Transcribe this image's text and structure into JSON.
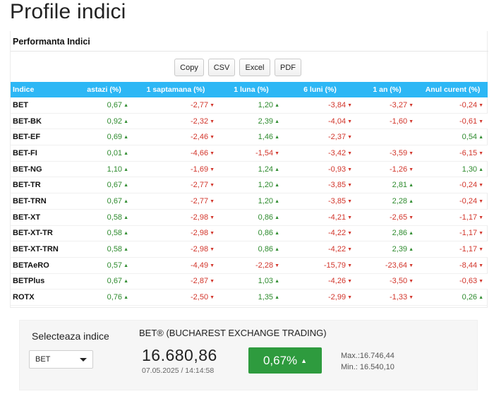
{
  "page": {
    "title": "Profile indici"
  },
  "performance": {
    "title": "Performanta Indici",
    "export_buttons": [
      "Copy",
      "CSV",
      "Excel",
      "PDF"
    ],
    "columns": [
      "Indice",
      "astazi (%)",
      "1 saptamana (%)",
      "1 luna (%)",
      "6 luni (%)",
      "1 an (%)",
      "Anul curent (%)"
    ],
    "rows": [
      {
        "name": "BET",
        "cells": [
          "0,67",
          "-2,77",
          "1,20",
          "-3,84",
          "-3,27",
          "-0,24"
        ]
      },
      {
        "name": "BET-BK",
        "cells": [
          "0,92",
          "-2,32",
          "2,39",
          "-4,04",
          "-1,60",
          "-0,61"
        ]
      },
      {
        "name": "BET-EF",
        "cells": [
          "0,69",
          "-2,46",
          "1,46",
          "-2,37",
          "",
          "0,54"
        ]
      },
      {
        "name": "BET-FI",
        "cells": [
          "0,01",
          "-4,66",
          "-1,54",
          "-3,42",
          "-3,59",
          "-6,15"
        ]
      },
      {
        "name": "BET-NG",
        "cells": [
          "1,10",
          "-1,69",
          "1,24",
          "-0,93",
          "-1,26",
          "1,30"
        ]
      },
      {
        "name": "BET-TR",
        "cells": [
          "0,67",
          "-2,77",
          "1,20",
          "-3,85",
          "2,81",
          "-0,24"
        ]
      },
      {
        "name": "BET-TRN",
        "cells": [
          "0,67",
          "-2,77",
          "1,20",
          "-3,85",
          "2,28",
          "-0,24"
        ]
      },
      {
        "name": "BET-XT",
        "cells": [
          "0,58",
          "-2,98",
          "0,86",
          "-4,21",
          "-2,65",
          "-1,17"
        ]
      },
      {
        "name": "BET-XT-TR",
        "cells": [
          "0,58",
          "-2,98",
          "0,86",
          "-4,22",
          "2,86",
          "-1,17"
        ]
      },
      {
        "name": "BET-XT-TRN",
        "cells": [
          "0,58",
          "-2,98",
          "0,86",
          "-4,22",
          "2,39",
          "-1,17"
        ]
      },
      {
        "name": "BETAeRO",
        "cells": [
          "0,57",
          "-4,49",
          "-2,28",
          "-15,79",
          "-23,64",
          "-8,44"
        ]
      },
      {
        "name": "BETPlus",
        "cells": [
          "0,67",
          "-2,87",
          "1,03",
          "-4,26",
          "-3,50",
          "-0,63"
        ]
      },
      {
        "name": "ROTX",
        "cells": [
          "0,76",
          "-2,50",
          "1,35",
          "-2,99",
          "-1,33",
          "0,26"
        ]
      }
    ],
    "colors": {
      "header_bg": "#2db7f5",
      "up": "#2e8b2e",
      "down": "#d2352b"
    },
    "icons": {
      "up": "triangle-up-icon",
      "down": "triangle-down-icon"
    }
  },
  "selector": {
    "label": "Selecteaza indice",
    "selected": "BET",
    "index_name": "BET® (BUCHAREST EXCHANGE TRADING)",
    "value": "16.680,86",
    "timestamp": "07.05.2025 / 14:14:58",
    "change": "0,67%",
    "change_color": "#2e9b3e",
    "max": "Max.:16.746,44",
    "min": "Min.: 16.540,10"
  }
}
